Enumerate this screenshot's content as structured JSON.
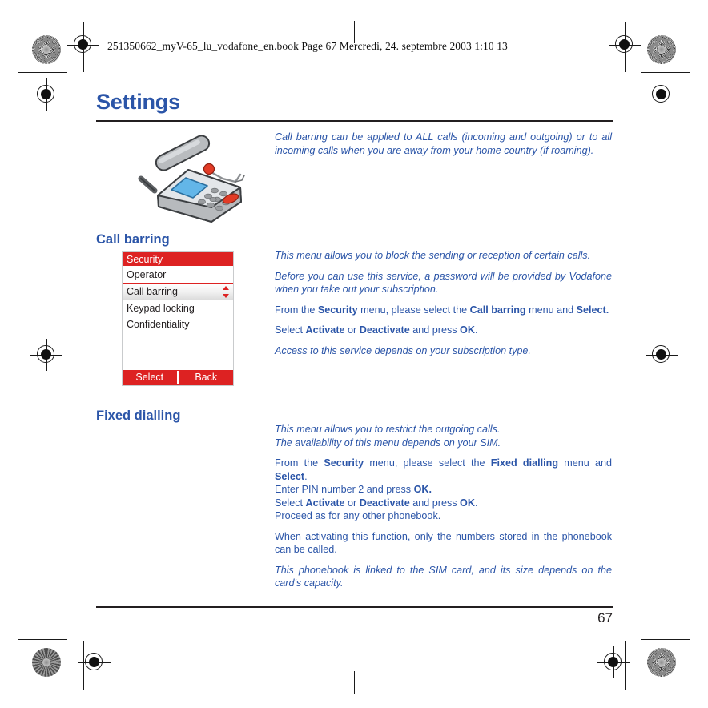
{
  "document": {
    "file_header": "251350662_myV-65_lu_vodafone_en.book  Page 67  Mercredi, 24. septembre 2003  1:10 13",
    "chapter_title": "Settings",
    "page_number": "67",
    "accent_color": "#2b55a8",
    "rule_color": "#231f20",
    "phone_accent_color": "#dd2222"
  },
  "illustration": {
    "name": "mobile-phone-with-headset",
    "alt": "Mobile phone lying flat with a wired headset above it"
  },
  "intro": {
    "paragraphs": [
      {
        "style": "italic",
        "runs": [
          {
            "t": "Call barring can be applied to ALL calls (incoming and outgoing) or to all incoming calls when you are away from your home country (if roaming)."
          }
        ]
      }
    ]
  },
  "sections": [
    {
      "id": "call-barring",
      "heading": "Call barring",
      "paragraphs": [
        {
          "style": "italic",
          "runs": [
            {
              "t": "This menu allows you to block the sending or reception of certain calls."
            }
          ]
        },
        {
          "style": "italic",
          "runs": [
            {
              "t": "Before you can use this service, a password will be provided by Vodafone when you take out your subscription."
            }
          ]
        },
        {
          "style": "normal",
          "runs": [
            {
              "t": "From the "
            },
            {
              "t": "Security",
              "b": true
            },
            {
              "t": " menu, please select the "
            },
            {
              "t": "Call barring",
              "b": true
            },
            {
              "t": " menu and "
            },
            {
              "t": "Select.",
              "b": true
            }
          ]
        },
        {
          "style": "normal",
          "runs": [
            {
              "t": "Select "
            },
            {
              "t": "Activate",
              "b": true
            },
            {
              "t": " or "
            },
            {
              "t": "Deactivate",
              "b": true
            },
            {
              "t": " and press "
            },
            {
              "t": "OK",
              "b": true
            },
            {
              "t": "."
            }
          ]
        },
        {
          "style": "italic",
          "runs": [
            {
              "t": "Access to this service depends on your subscription type."
            }
          ]
        }
      ]
    },
    {
      "id": "fixed-dialling",
      "heading": "Fixed dialling",
      "paragraphs": [
        {
          "style": "italic",
          "nojust": true,
          "runs": [
            {
              "t": "This menu allows you to restrict the outgoing calls."
            },
            {
              "br": true
            },
            {
              "t": "The availability of this menu depends on your SIM."
            }
          ]
        },
        {
          "style": "normal",
          "runs": [
            {
              "t": "From the "
            },
            {
              "t": "Security",
              "b": true
            },
            {
              "t": " menu, please select the "
            },
            {
              "t": "Fixed dialling",
              "b": true
            },
            {
              "t": " menu and "
            },
            {
              "t": "Select",
              "b": true
            },
            {
              "t": "."
            },
            {
              "br": true,
              "nojust": true
            },
            {
              "t": "Enter PIN number 2 and press "
            },
            {
              "t": "OK.",
              "b": true
            },
            {
              "br": true
            },
            {
              "t": "Select "
            },
            {
              "t": "Activate",
              "b": true
            },
            {
              "t": " or "
            },
            {
              "t": "Deactivate",
              "b": true
            },
            {
              "t": " and press "
            },
            {
              "t": "OK",
              "b": true
            },
            {
              "t": "."
            },
            {
              "br": true
            },
            {
              "t": "Proceed as for any other phonebook."
            }
          ]
        },
        {
          "style": "normal",
          "runs": [
            {
              "t": "When activating this function, only the numbers stored in the phonebook can be called."
            }
          ]
        },
        {
          "style": "italic",
          "runs": [
            {
              "t": "This phonebook is linked to the SIM card, and its size depends on the card's capacity."
            }
          ]
        }
      ]
    }
  ],
  "phone_screen": {
    "title": "Security",
    "items": [
      {
        "label": "Operator",
        "selected": false
      },
      {
        "label": "Call barring",
        "selected": true
      },
      {
        "label": "Keypad locking",
        "selected": false
      },
      {
        "label": "Confidentiality",
        "selected": false
      }
    ],
    "scroll_indicator": {
      "up": "scroll-up-arrow",
      "down": "scroll-down-arrow"
    },
    "softkeys": {
      "left": "Select",
      "right": "Back"
    }
  }
}
